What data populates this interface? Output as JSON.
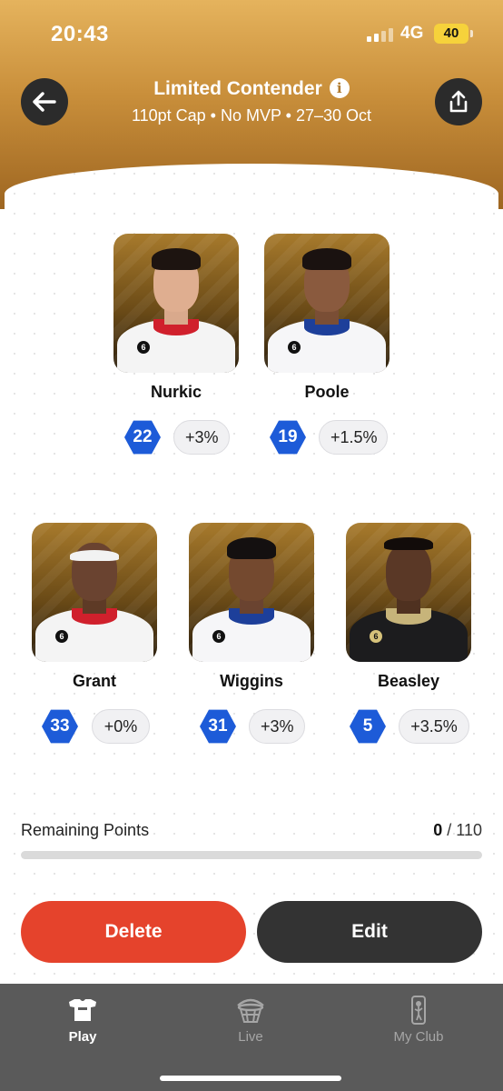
{
  "status_bar": {
    "time": "20:43",
    "network": "4G",
    "battery": "40"
  },
  "header": {
    "title": "Limited Contender",
    "info_icon": "i",
    "subtitle": "110pt Cap • No MVP • 27–30 Oct"
  },
  "players": [
    {
      "name": "Nurkic",
      "score": "22",
      "bonus": "+3%",
      "jersey": "6"
    },
    {
      "name": "Poole",
      "score": "19",
      "bonus": "+1.5%",
      "jersey": "6"
    },
    {
      "name": "Grant",
      "score": "33",
      "bonus": "+0%",
      "jersey": "6"
    },
    {
      "name": "Wiggins",
      "score": "31",
      "bonus": "+3%",
      "jersey": "6"
    },
    {
      "name": "Beasley",
      "score": "5",
      "bonus": "+3.5%",
      "jersey": "6"
    }
  ],
  "remaining": {
    "label": "Remaining Points",
    "used": "0",
    "separator": "/",
    "cap": "110",
    "progress_fraction": 0
  },
  "actions": {
    "delete_label": "Delete",
    "edit_label": "Edit"
  },
  "tabs": [
    {
      "label": "Play",
      "icon": "jersey-icon",
      "active": true
    },
    {
      "label": "Live",
      "icon": "basketball-hoop-icon",
      "active": false
    },
    {
      "label": "My Club",
      "icon": "nba-logo-icon",
      "active": false
    }
  ],
  "colors": {
    "header_gold": "#c98f3b",
    "score_blue": "#1d5bd8",
    "delete_red": "#e5432c",
    "edit_dark": "#333333",
    "tabbar": "#5a5a5a"
  }
}
